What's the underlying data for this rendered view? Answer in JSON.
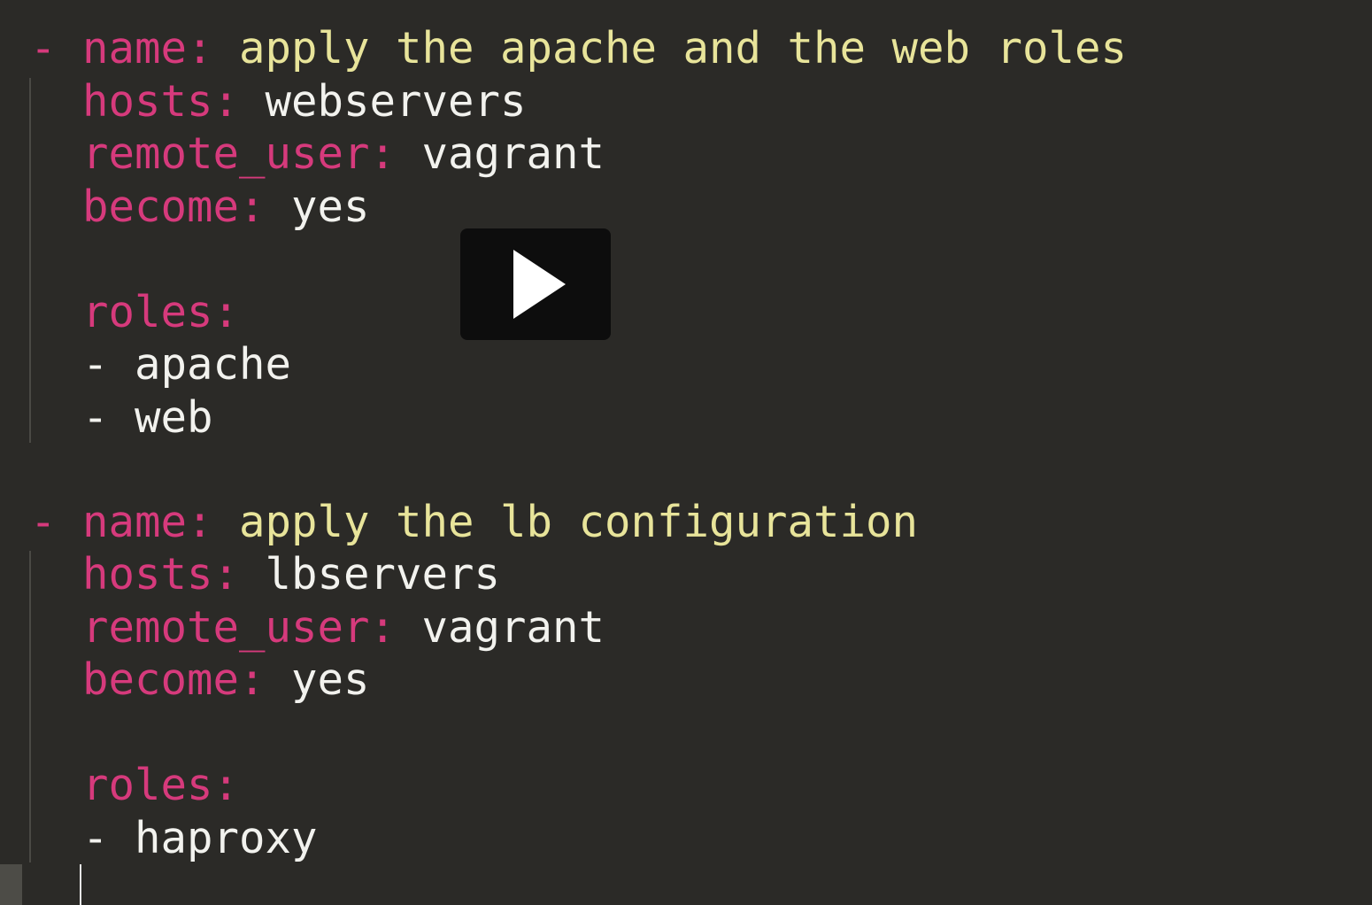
{
  "colors": {
    "background": "#2b2a27",
    "key": "#d63a7c",
    "string": "#e8e49a",
    "value": "#f2f2ee",
    "indent_guide": "#4a4944",
    "play_button": "#0d0d0d"
  },
  "play_button": {
    "icon": "play-icon"
  },
  "plays": [
    {
      "dash": "-",
      "name_key": "name:",
      "name_value": "apply the apache and the web roles",
      "hosts_key": "hosts:",
      "hosts_value": "webservers",
      "remote_user_key": "remote_user:",
      "remote_user_value": "vagrant",
      "become_key": "become:",
      "become_value": "yes",
      "roles_key": "roles:",
      "roles": [
        {
          "dash": "-",
          "value": "apache"
        },
        {
          "dash": "-",
          "value": "web"
        }
      ]
    },
    {
      "dash": "-",
      "name_key": "name:",
      "name_value": "apply the lb configuration",
      "hosts_key": "hosts:",
      "hosts_value": "lbservers",
      "remote_user_key": "remote_user:",
      "remote_user_value": "vagrant",
      "become_key": "become:",
      "become_value": "yes",
      "roles_key": "roles:",
      "roles": [
        {
          "dash": "-",
          "value": "haproxy"
        }
      ]
    }
  ]
}
